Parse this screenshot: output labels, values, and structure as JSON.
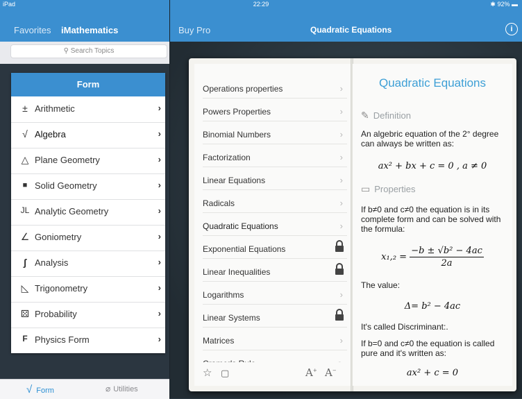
{
  "status": {
    "device": "iPad",
    "time": "22:29",
    "battery": "92%"
  },
  "left": {
    "nav": {
      "back": "Favorites",
      "title": "iMathematics"
    },
    "search_placeholder": "Search Topics",
    "form_header": "Form",
    "items": [
      {
        "icon": "±",
        "label": "Arithmetic"
      },
      {
        "icon": "√",
        "label": "Algebra"
      },
      {
        "icon": "△",
        "label": "Plane Geometry"
      },
      {
        "icon": "■",
        "label": "Solid Geometry"
      },
      {
        "icon": "JL",
        "label": "Analytic Geometry"
      },
      {
        "icon": "∠",
        "label": "Goniometry"
      },
      {
        "icon": "ʃ",
        "label": "Analysis"
      },
      {
        "icon": "◺",
        "label": "Trigonometry"
      },
      {
        "icon": "⚄",
        "label": "Probability"
      },
      {
        "icon": "F",
        "label": "Physics Form"
      }
    ],
    "tabs": {
      "form": "Form",
      "utilities": "Utilities"
    }
  },
  "right": {
    "nav": {
      "buy": "Buy Pro",
      "title": "Quadratic Equations"
    },
    "topics": [
      {
        "label": "Operations properties",
        "locked": false
      },
      {
        "label": "Powers Properties",
        "locked": false
      },
      {
        "label": "Binomial Numbers",
        "locked": false
      },
      {
        "label": "Factorization",
        "locked": false
      },
      {
        "label": "Linear Equations",
        "locked": false
      },
      {
        "label": "Radicals",
        "locked": false
      },
      {
        "label": "Quadratic Equations",
        "locked": false
      },
      {
        "label": "Exponential Equations",
        "locked": true
      },
      {
        "label": "Linear Inequalities",
        "locked": true
      },
      {
        "label": "Logarithms",
        "locked": false
      },
      {
        "label": "Linear Systems",
        "locked": true
      },
      {
        "label": "Matrices",
        "locked": false
      },
      {
        "label": "Cramer's Rule",
        "locked": false
      }
    ],
    "page": {
      "title": "Quadratic Equations",
      "definition_heading": "Definition",
      "definition_text": "An algebric equation of the 2° degree can always be written as:",
      "formula_general": "ax² + bx + c = 0 , a ≠ 0",
      "properties_heading": "Properties",
      "properties_text": "If b≠0 and c≠0 the equation is in its complete form and can be solved with the formula:",
      "formula_roots_lhs": "x₁,₂ =",
      "formula_roots_num": "−b ± √b² − 4ac",
      "formula_roots_den": "2a",
      "value_text": "The value:",
      "formula_delta": "Δ= b² − 4ac",
      "discriminant_text": "It's called Discriminant:.",
      "pure_text": "If b=0 and c≠0 the equation is called pure and it's written as:",
      "formula_pure": "ax² + c = 0"
    }
  }
}
